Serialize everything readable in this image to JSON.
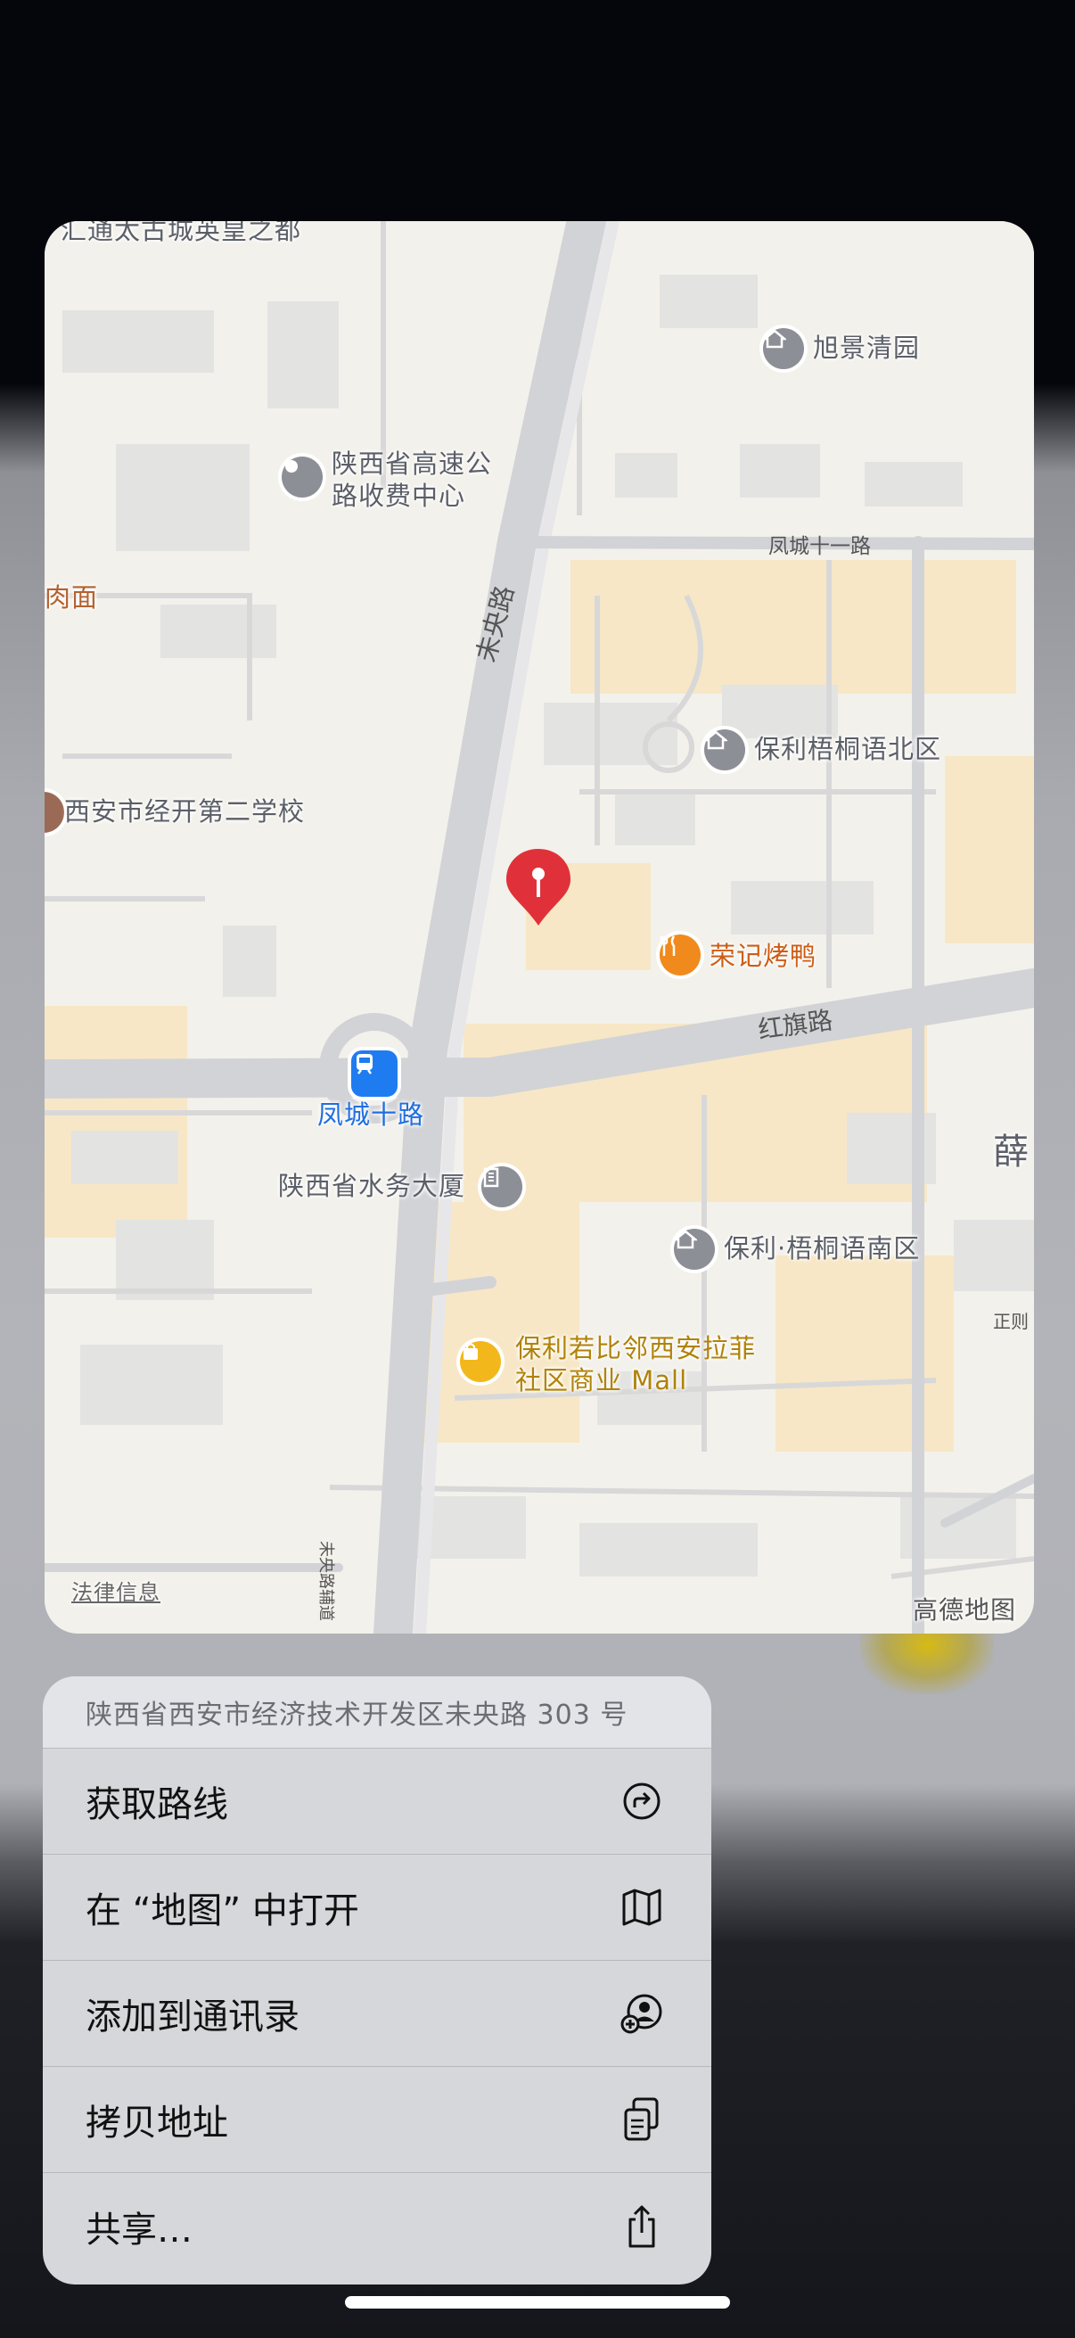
{
  "map": {
    "labels": {
      "huitong": "汇通太古城英皇之都",
      "xujing": "旭景清园",
      "shaanxi_toll_1": "陕西省高速公",
      "shaanxi_toll_2": "路收费中心",
      "roumian": "肉面",
      "poly_north": "保利梧桐语北区",
      "school": "西安市经开第二学校",
      "rongji": "荣记烤鸭",
      "station": "凤城十路",
      "water_bldg": "陕西省水务大厦",
      "poly_south": "保利·梧桐语南区",
      "mall_1": "保利若比邻西安拉菲",
      "mall_2": "社区商业 Mall",
      "xue": "薛"
    },
    "roads": {
      "weiyang": "未央路",
      "fengcheng11": "凤城十一路",
      "hongqi": "红旗路",
      "zhengji": "正则",
      "weiyang_aux": "未央路辅道"
    },
    "legal": "法律信息",
    "attribution": "高德地图"
  },
  "menu": {
    "address": "陕西省西安市经济技术开发区未央路 303 号",
    "items": [
      {
        "label": "获取路线",
        "icon": "directions-icon"
      },
      {
        "label": "在 “地图” 中打开",
        "icon": "map-icon"
      },
      {
        "label": "添加到通讯录",
        "icon": "add-contact-icon"
      },
      {
        "label": "拷贝地址",
        "icon": "copy-icon"
      },
      {
        "label": "共享…",
        "icon": "share-icon"
      }
    ]
  },
  "colors": {
    "pin": "#e0313a",
    "food": "#f08a1c",
    "transit": "#1f7cf0",
    "shopping": "#f2b81b"
  }
}
